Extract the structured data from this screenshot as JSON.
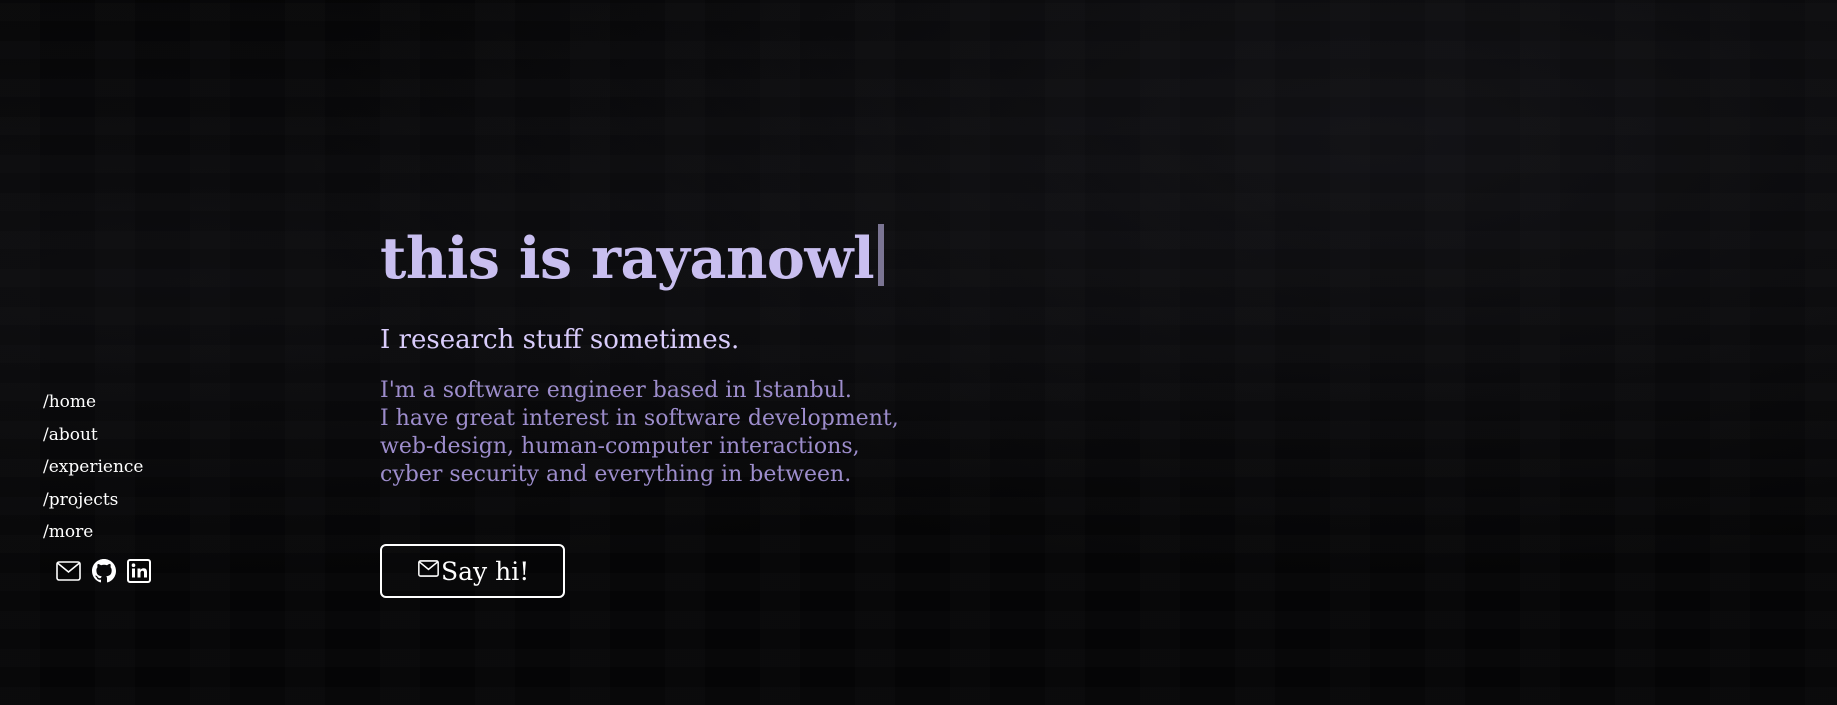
{
  "colors": {
    "background": "#050506",
    "title": "#c9bff0",
    "cursor": "#7b7593",
    "subtitle": "#d9ccfb",
    "bio": "#9d8dcc",
    "nav_text": "#ffffff",
    "button_border": "#ffffff"
  },
  "sidebar": {
    "nav": [
      {
        "label": "/home"
      },
      {
        "label": "/about"
      },
      {
        "label": "/experience"
      },
      {
        "label": "/projects"
      },
      {
        "label": "/more"
      }
    ],
    "socials": [
      {
        "icon": "mail-icon"
      },
      {
        "icon": "github-icon"
      },
      {
        "icon": "linkedin-icon"
      }
    ]
  },
  "hero": {
    "title": "this is rayanowl",
    "subtitle": "I research stuff sometimes.",
    "bio_lines": [
      "I'm a software engineer based in Istanbul.",
      "I have great interest in software development,",
      "web-design, human-computer interactions,",
      "cyber security and everything in between."
    ],
    "cta_label": "Say hi!",
    "cta_icon": "mail-icon"
  }
}
